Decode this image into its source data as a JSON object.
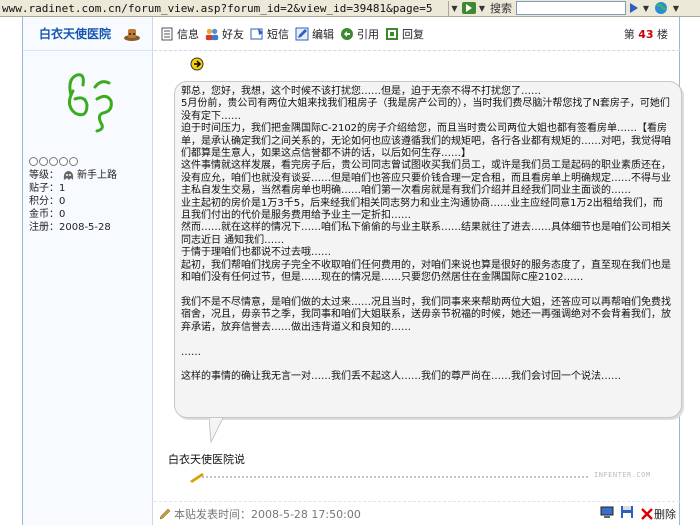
{
  "browser": {
    "url": "www.radinet.com.cn/forum_view.asp?forum_id=2&view_id=39481&page=5",
    "search_label": "搜索"
  },
  "author": {
    "name": "白衣天使医院",
    "level_label": "等级：",
    "level_value": "新手上路",
    "posts": "贴子：1",
    "points": "积分：0",
    "money": "金币：0",
    "registered": "注册：2008-5-28"
  },
  "toolbar": {
    "info": "信息",
    "friend": "好友",
    "message": "短信",
    "edit": "编辑",
    "quote": "引用",
    "reply": "回复",
    "floor_prefix": "第",
    "floor_num": "43",
    "floor_suffix": "楼"
  },
  "post": {
    "body": "郭总，您好，我想，这个时候不该打扰您……但是，迫于无奈不得不打扰您了……\n5月份前，贵公司有两位大姐来找我们租房子（我是房产公司的），当时我们费尽脑汁帮您找了N套房子，可她们没有定下……\n迫于时间压力，我们把金隅国际C-2102的房子介绍给您，而且当时贵公司两位大姐也都有签看房单……【看房单，是承认确定我们之间关系的，无论如何也应该遵循我们的规矩吧，各行各业都有规矩的……对吧，我觉得咱们都算是生意人，如果这点信誉都不讲的话，以后如何生存……】\n这件事情就这样发展，看完房子后，贵公司同志曾试图收买我们员工，或许是我们员工是起码的职业素质还在，没有应允，咱们也就没有谈妥……但是咱们也答应只要价钱合理一定合租，而且看房单上明确规定……不得与业主私自发生交易，当然看房单也明确……咱们第一次看房就是有我们介绍并且经我们同业主面谈的……\n业主起初的房价是1万3千5，后来经我们相关同志努力和业主沟通协商……业主应经同意1万2出租给我们，而且我们付出的代价是服务费用给予业主一定折扣……\n然而……就在这样的情况下……咱们私下偷偷的与业主联系……结果就往了进去……具体细节也是咱们公司相关同志近日 通知我们……\n于情于理咱们也都说不过去哦……\n起初，我们帮咱们找房子完全不收取咱们任何费用的，对咱们来说也算是很好的服务态度了，直至现在我们也是和咱们没有任何过节，但是……现在的情况是……只要您仍然居住在金隅国际C座2102……\n\n我们不是不尽情意，是咱们做的太过来……况且当时，我们同事来来帮助两位大姐，还答应可以再帮咱们免费找宿舍，况且，毋亲节之季，我同事和咱们大姐联系，送毋亲节祝福的时候，她还一再强调绝对不会背着我们，放弃承诺，放弃信誉去……做出违背道义和良知的……\n\n……\n\n这样的事情的确让我无言一对……我们丢不起这人……我们的尊严尚在……我们会讨回一个说法……"
  },
  "signature": {
    "name": "白衣天使医院说"
  },
  "footer": {
    "posted_label": "本贴发表时间：2008-5-28 17:50:00",
    "delete_label": "删除"
  },
  "colors": {
    "accent": "#1556b0",
    "floor_red": "#cc0000",
    "bubble_bg": "#f4f4f4"
  }
}
